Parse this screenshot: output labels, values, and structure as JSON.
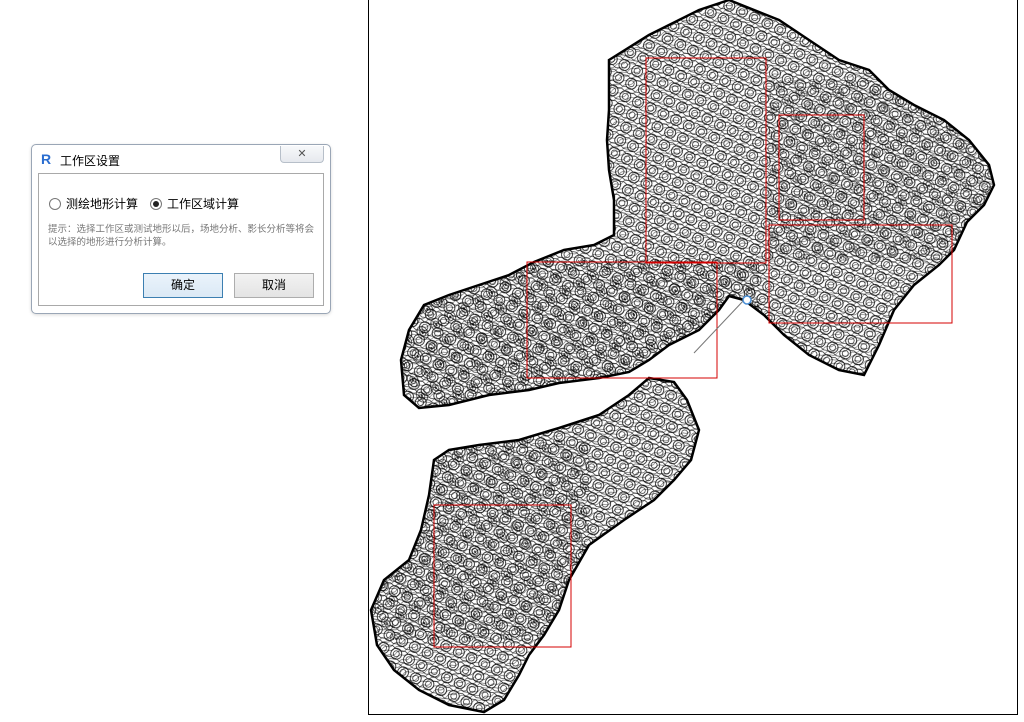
{
  "dialog": {
    "title": "工作区设置",
    "close_glyph": "✕",
    "app_icon_letter": "R",
    "options": [
      {
        "label": "测绘地形计算",
        "checked": false
      },
      {
        "label": "工作区域计算",
        "checked": true
      }
    ],
    "hint": "提示：选择工作区或测试地形以后，场地分析、影长分析等将会以选择的地形进行分析计算。",
    "ok_label": "确定",
    "cancel_label": "取消"
  },
  "colors": {
    "accent": "#2a6dd0",
    "selection_box": "#d40000",
    "contour": "#000000"
  },
  "icons": {
    "app": "revit-r-icon",
    "close": "close-icon",
    "cursor": "cursor-node-icon"
  }
}
